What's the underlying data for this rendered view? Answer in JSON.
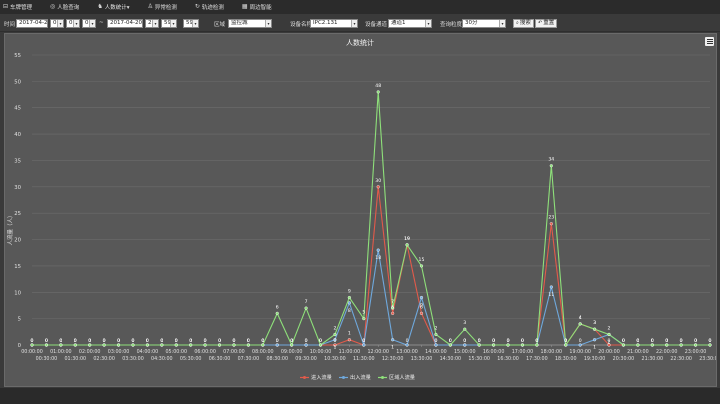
{
  "nav": {
    "items": [
      {
        "icon": "⊟",
        "label": "车牌管理"
      },
      {
        "icon": "◎",
        "label": "人脸查询"
      },
      {
        "icon": "♞",
        "label": "人数统计▾"
      },
      {
        "icon": "♙",
        "label": "异常检测"
      },
      {
        "icon": "↻",
        "label": "轨迹检测"
      },
      {
        "icon": "▦",
        "label": "周边智能"
      }
    ]
  },
  "filters": {
    "time_label": "时间",
    "start_date": "2017-04-20",
    "start_hour": "0",
    "start_min": "0",
    "start_sec": "0",
    "tilde": "~",
    "end_date": "2017-04-20",
    "end_hour": "23",
    "end_min": "59",
    "end_sec": "59",
    "area_label": "区域",
    "area_value": "监控城",
    "device_label": "设备名称",
    "device_value": "IPC2.131",
    "channel_label": "设备通道",
    "channel_value": "通道1",
    "granularity_label": "查询粒度",
    "granularity_value": "30分",
    "search_button": "搜索",
    "reset_button": "重置"
  },
  "colors": {
    "enter": "#e25a4a",
    "exit": "#6fa8dc",
    "inside": "#8ee07a",
    "grid": "#6d6d6d",
    "axis_text": "#e0e0e0"
  },
  "chart_data": {
    "type": "line",
    "title": "人数统计",
    "ylabel": "人流量（人）",
    "xlabel": "",
    "ylim": [
      0,
      55
    ],
    "yticks": [
      0,
      5,
      10,
      15,
      20,
      25,
      30,
      35,
      40,
      45,
      50,
      55
    ],
    "grid": true,
    "legend_position": "bottom-center",
    "categories": [
      "00:00:00",
      "00:30:00",
      "01:00:00",
      "01:30:00",
      "02:00:00",
      "02:30:00",
      "03:00:00",
      "03:30:00",
      "04:00:00",
      "04:30:00",
      "05:00:00",
      "05:30:00",
      "06:00:00",
      "06:30:00",
      "07:00:00",
      "07:30:00",
      "08:00:00",
      "08:30:00",
      "09:00:00",
      "09:30:00",
      "10:00:00",
      "10:30:00",
      "11:00:00",
      "11:30:00",
      "12:00:00",
      "12:30:00",
      "13:00:00",
      "13:30:00",
      "14:00:00",
      "14:30:00",
      "15:00:00",
      "15:30:00",
      "16:00:00",
      "16:30:00",
      "17:00:00",
      "17:30:00",
      "18:00:00",
      "18:30:00",
      "19:00:00",
      "19:30:00",
      "20:00:00",
      "20:30:00",
      "21:00:00",
      "21:30:00",
      "22:00:00",
      "22:30:00",
      "23:00:00",
      "23:30:00"
    ],
    "series": [
      {
        "name": "进入流量",
        "color": "#e25a4a",
        "values": [
          0,
          0,
          0,
          0,
          0,
          0,
          0,
          0,
          0,
          0,
          0,
          0,
          0,
          0,
          0,
          0,
          0,
          0,
          0,
          0,
          0,
          0,
          1,
          0,
          30,
          6,
          19,
          6,
          0,
          0,
          0,
          0,
          0,
          0,
          0,
          0,
          23,
          0,
          4,
          3,
          0,
          0,
          0,
          0,
          0,
          0,
          0,
          0
        ]
      },
      {
        "name": "出入流量",
        "color": "#6fa8dc",
        "values": [
          0,
          0,
          0,
          0,
          0,
          0,
          0,
          0,
          0,
          0,
          0,
          0,
          0,
          0,
          0,
          0,
          0,
          0,
          0,
          0,
          0,
          1,
          8,
          0,
          18,
          1,
          0,
          9,
          0,
          0,
          0,
          0,
          0,
          0,
          0,
          0,
          11,
          0,
          0,
          1,
          2,
          0,
          0,
          0,
          0,
          0,
          0,
          0
        ]
      },
      {
        "name": "区域人流量",
        "color": "#8ee07a",
        "values": [
          0,
          0,
          0,
          0,
          0,
          0,
          0,
          0,
          0,
          0,
          0,
          0,
          0,
          0,
          0,
          0,
          0,
          6,
          0,
          7,
          0,
          2,
          9,
          5,
          48,
          7,
          19,
          15,
          2,
          0,
          3,
          0,
          0,
          0,
          0,
          0,
          34,
          0,
          4,
          3,
          2,
          0,
          0,
          0,
          0,
          0,
          0,
          0
        ]
      }
    ]
  }
}
